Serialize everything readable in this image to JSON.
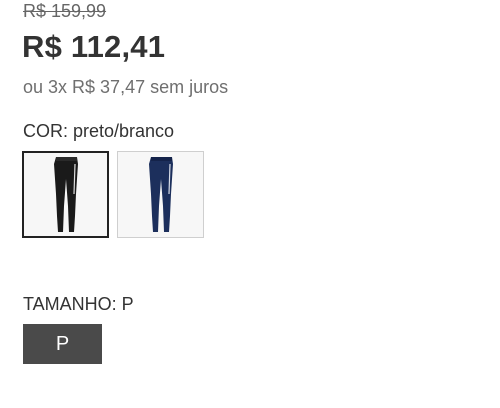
{
  "pricing": {
    "old_price": "R$ 159,99",
    "price": "R$ 112,41",
    "installments": "ou 3x R$ 37,47 sem juros"
  },
  "color": {
    "label": "COR: preto/branco",
    "swatches": [
      {
        "name": "preto/branco",
        "hex": "#1a1a1a",
        "selected": true
      },
      {
        "name": "azul",
        "hex": "#1c2f5c",
        "selected": false
      }
    ]
  },
  "size": {
    "label": "TAMANHO: P",
    "options": [
      {
        "label": "P",
        "selected": true
      }
    ]
  },
  "colors": {
    "text": "#333333",
    "muted": "#6f6f6f",
    "size_button_bg": "#4a4a4a"
  }
}
